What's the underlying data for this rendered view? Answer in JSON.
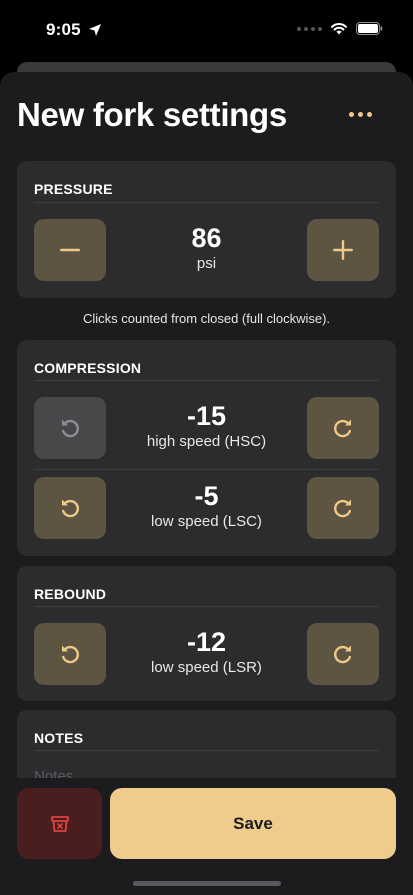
{
  "status_bar": {
    "time": "9:05"
  },
  "header": {
    "title": "New fork settings"
  },
  "pressure": {
    "title": "PRESSURE",
    "value": "86",
    "unit": "psi"
  },
  "hint": "Clicks counted from closed (full clockwise).",
  "compression": {
    "title": "COMPRESSION",
    "rows": [
      {
        "value": "-15",
        "label": "high speed (HSC)",
        "decrease_disabled": true
      },
      {
        "value": "-5",
        "label": "low speed (LSC)",
        "decrease_disabled": false
      }
    ]
  },
  "rebound": {
    "title": "REBOUND",
    "rows": [
      {
        "value": "-12",
        "label": "low speed (LSR)"
      }
    ]
  },
  "notes": {
    "title": "NOTES",
    "placeholder": "Notes"
  },
  "actions": {
    "save_label": "Save"
  },
  "colors": {
    "accent": "#f0c98a",
    "button_bg": "#5d5442",
    "disabled_bg": "#48484a",
    "danger_bg": "#4a1d1f",
    "danger_icon": "#e0443e"
  }
}
